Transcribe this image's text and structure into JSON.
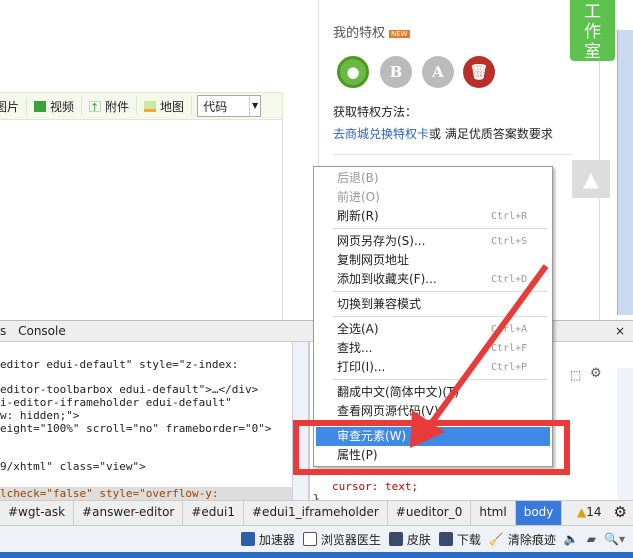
{
  "editor_toolbar": {
    "items": [
      {
        "label": "图片",
        "icon": "image-icon"
      },
      {
        "label": "视频",
        "icon": "video-icon"
      },
      {
        "label": "附件",
        "icon": "attachment-icon"
      },
      {
        "label": "地图",
        "icon": "map-icon"
      }
    ],
    "format_select": "代码"
  },
  "privilege": {
    "title": "我的特权",
    "badge": "NEW",
    "method_label": "获取特权方法：",
    "link": "去商城兑换特权卡",
    "link_suffix": "或 满足优质答案数要求"
  },
  "studio_tab": "工\n作\n室",
  "devtools": {
    "tab_partial": "s",
    "console_tab": "Console",
    "code_lines": [
      "editor edui-default\" style=\"z-index:",
      "editor-toolbarbox edui-default\">…</div>",
      "i-editor-iframeholder edui-default\"",
      "w: hidden;\">",
      "eight=\"100%\" scroll=\"no\" frameborder=\"0\">",
      "9/xhtml\" class=\"view\">",
      "lcheck=\"false\" style=\"overflow-y:"
    ],
    "style_lines": [
      "cursor: text;",
      "}"
    ],
    "breadcrumbs": [
      "#wgt-ask",
      "#answer-editor",
      "#edui1",
      "#edui1_iframeholder",
      "#ueditor_0",
      "html",
      "body"
    ],
    "warnings": "14"
  },
  "status_bar": {
    "items": [
      "加速器",
      "浏览器医生",
      "皮肤",
      "下载",
      "清除痕迹"
    ]
  },
  "context_menu": {
    "items": [
      {
        "label": "后退(B)",
        "disabled": true
      },
      {
        "label": "前进(O)",
        "disabled": true
      },
      {
        "label": "刷新(R)",
        "shortcut": "Ctrl+R"
      },
      {
        "sep": true
      },
      {
        "label": "网页另存为(S)...",
        "shortcut": "Ctrl+S"
      },
      {
        "label": "复制网页地址"
      },
      {
        "label": "添加到收藏夹(F)...",
        "shortcut": "Ctrl+D"
      },
      {
        "sep": true
      },
      {
        "label": "切换到兼容模式"
      },
      {
        "sep": true
      },
      {
        "label": "全选(A)",
        "shortcut": "Ctrl+A"
      },
      {
        "label": "查找...",
        "shortcut": "Ctrl+F"
      },
      {
        "label": "打印(I)...",
        "shortcut": "Ctrl+P"
      },
      {
        "sep": true
      },
      {
        "label": "翻成中文(简体中文)(T)"
      },
      {
        "label": "查看网页源代码(V)"
      },
      {
        "sep": true
      },
      {
        "label": "审查元素(W)",
        "highlighted": true
      },
      {
        "label": "属性(P)"
      }
    ]
  },
  "colors": {
    "accent": "#3f8ae6",
    "annotation": "#ea3b3b",
    "studio": "#5cc24d"
  }
}
